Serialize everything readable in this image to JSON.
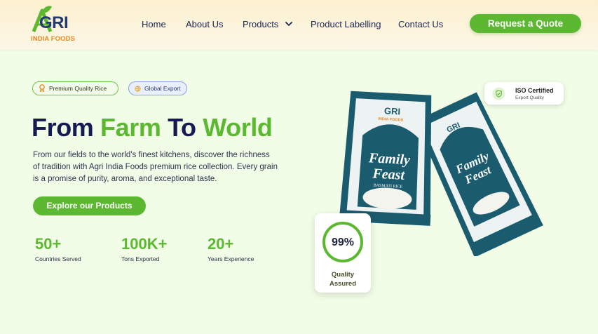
{
  "brand": {
    "name": "GRI",
    "subtitle": "INDIA FOODS"
  },
  "nav": {
    "items": [
      {
        "label": "Home"
      },
      {
        "label": "About Us"
      },
      {
        "label": "Products"
      },
      {
        "label": "Product Labelling"
      },
      {
        "label": "Contact Us"
      }
    ],
    "cta_label": "Request a Quote"
  },
  "badges": [
    {
      "label": "Premium Quality Rice"
    },
    {
      "label": "Global Export"
    }
  ],
  "hero": {
    "title_part1": "From",
    "title_part2": "Farm",
    "title_part3": "To",
    "title_part4": "World",
    "description": "From our fields to the world's finest kitchens, discover the richness of tradition with Agri India Foods premium rice collection. Every grain is a promise of purity, aroma, and exceptional taste.",
    "button_label": "Explore our Products"
  },
  "stats": [
    {
      "value": "50+",
      "label": "Countries Served"
    },
    {
      "value": "100K+",
      "label": "Tons Exported"
    },
    {
      "value": "20+",
      "label": "Years Experience"
    }
  ],
  "iso_card": {
    "title": "ISO Certified",
    "subtitle": "Export Quality"
  },
  "quality_card": {
    "percent_text": "99%",
    "percent_value": 0.99,
    "label_line1": "Quality",
    "label_line2": "Assured"
  },
  "product": {
    "bag_brand": "GRI",
    "bag_brand_sub": "INDIA FOODS",
    "bag_title_line1": "Family",
    "bag_title_line2": "Feast",
    "bag_variety": "BASMATI RICE"
  },
  "colors": {
    "accent_green": "#5cb830",
    "navy": "#151b52",
    "bag_teal": "#1b5b6e",
    "page_bg": "#f1fde6"
  },
  "icons": [
    "leaf-icon",
    "medal-icon",
    "globe-icon",
    "chevron-down-icon",
    "shield-check-icon"
  ]
}
